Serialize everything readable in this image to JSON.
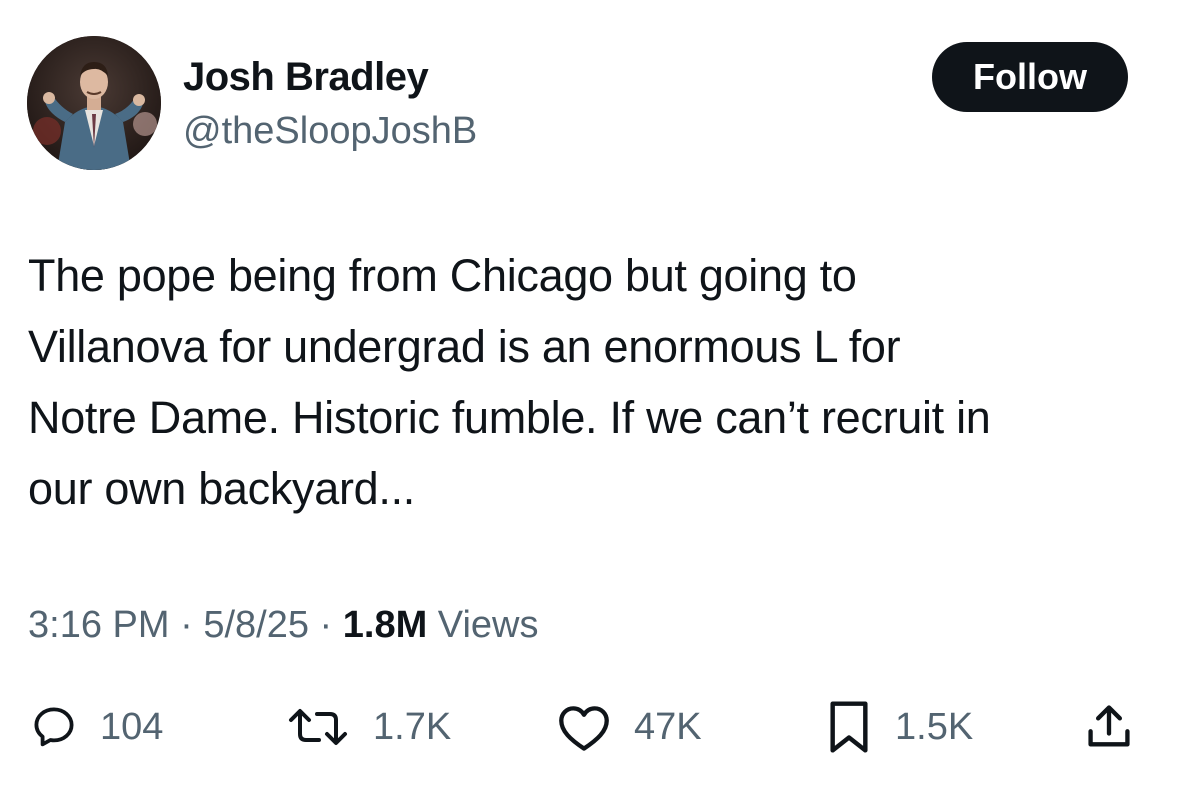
{
  "author": {
    "display_name": "Josh Bradley",
    "handle": "@theSloopJoshB"
  },
  "follow_button": {
    "label": "Follow"
  },
  "tweet": {
    "lines": [
      "The pope being from Chicago but going to",
      "Villanova for undergrad is an enormous L for",
      "Notre Dame. Historic fumble. If we can’t recruit in",
      "our own backyard..."
    ]
  },
  "meta": {
    "time": "3:16 PM",
    "date": "5/8/25",
    "separator": "·",
    "views_count": "1.8M",
    "views_label": "Views"
  },
  "actions": {
    "replies": "104",
    "reposts": "1.7K",
    "likes": "47K",
    "bookmarks": "1.5K"
  },
  "icons": {
    "reply": "reply-icon",
    "repost": "repost-icon",
    "like": "heart-icon",
    "bookmark": "bookmark-icon",
    "share": "share-icon"
  },
  "colors": {
    "text": "#0f1419",
    "secondary": "#536471",
    "follow_bg": "#0f1419",
    "background": "#ffffff"
  }
}
